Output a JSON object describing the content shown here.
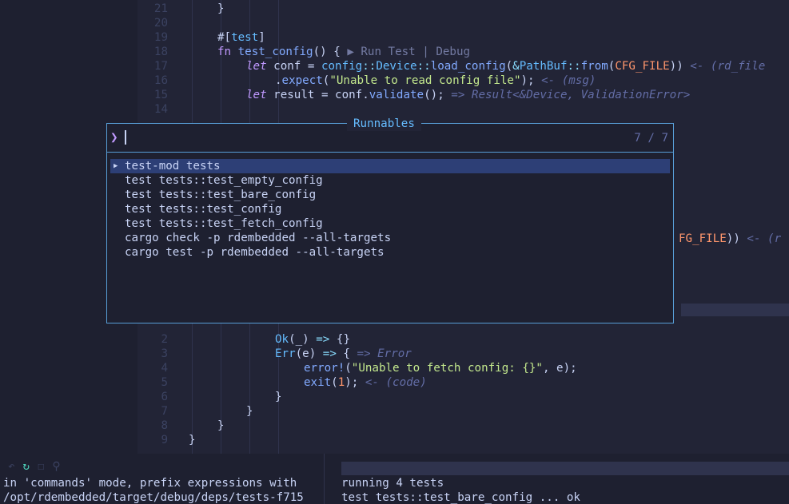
{
  "editor": {
    "lines_top": [
      {
        "n": "21",
        "indent": 100,
        "parts": [
          [
            "pl",
            "}"
          ]
        ]
      },
      {
        "n": "20",
        "indent": 0,
        "parts": []
      },
      {
        "n": "19",
        "indent": 100,
        "parts": [
          [
            "pl",
            "#["
          ],
          [
            "ty",
            "test"
          ],
          [
            "pl",
            "]"
          ]
        ]
      },
      {
        "n": "18",
        "indent": 100,
        "parts": [
          [
            "kw",
            "fn "
          ],
          [
            "fn",
            "test_config"
          ],
          [
            "pl",
            "() { "
          ],
          [
            "lens",
            "▶ Run Test | Debug"
          ]
        ]
      },
      {
        "n": "17",
        "indent": 136,
        "parts": [
          [
            "kwi",
            "let "
          ],
          [
            "pl",
            "conf = "
          ],
          [
            "ty",
            "config"
          ],
          [
            "op",
            "::"
          ],
          [
            "ty",
            "Device"
          ],
          [
            "op",
            "::"
          ],
          [
            "fn",
            "load_config"
          ],
          [
            "pl",
            "("
          ],
          [
            "op",
            "&"
          ],
          [
            "ty",
            "PathBuf"
          ],
          [
            "op",
            "::"
          ],
          [
            "fn",
            "from"
          ],
          [
            "pl",
            "("
          ],
          [
            "cst",
            "CFG_FILE"
          ],
          [
            "pl",
            ")) "
          ],
          [
            "hint",
            "<- (rd_file"
          ]
        ]
      },
      {
        "n": "16",
        "indent": 172,
        "parts": [
          [
            "pl",
            "."
          ],
          [
            "fn",
            "expect"
          ],
          [
            "pl",
            "("
          ],
          [
            "str",
            "\"Unable to read config file\""
          ],
          [
            "pl",
            "); "
          ],
          [
            "hint",
            "<- (msg)"
          ]
        ]
      },
      {
        "n": "15",
        "indent": 136,
        "parts": [
          [
            "kwi",
            "let "
          ],
          [
            "pl",
            "result = conf."
          ],
          [
            "fn",
            "validate"
          ],
          [
            "pl",
            "(); "
          ],
          [
            "hint",
            "=> Result<&Device, ValidationError>"
          ]
        ]
      },
      {
        "n": "14",
        "indent": 0,
        "parts": []
      }
    ],
    "lines_bottom": [
      {
        "n": "2",
        "indent": 172,
        "parts": [
          [
            "ty",
            "Ok"
          ],
          [
            "pl",
            "(_) "
          ],
          [
            "op",
            "=>"
          ],
          [
            "pl",
            " {}"
          ]
        ]
      },
      {
        "n": "3",
        "indent": 172,
        "parts": [
          [
            "ty",
            "Err"
          ],
          [
            "pl",
            "(e) "
          ],
          [
            "op",
            "=>"
          ],
          [
            "pl",
            " { "
          ],
          [
            "hint",
            "=> Error"
          ]
        ]
      },
      {
        "n": "4",
        "indent": 208,
        "parts": [
          [
            "fn",
            "error!"
          ],
          [
            "pl",
            "("
          ],
          [
            "str",
            "\"Unable to fetch config: {}\""
          ],
          [
            "pl",
            ", e);"
          ]
        ]
      },
      {
        "n": "5",
        "indent": 208,
        "parts": [
          [
            "fn",
            "exit"
          ],
          [
            "pl",
            "("
          ],
          [
            "num",
            "1"
          ],
          [
            "pl",
            "); "
          ],
          [
            "hint",
            "<- (code)"
          ]
        ]
      },
      {
        "n": "6",
        "indent": 172,
        "parts": [
          [
            "pl",
            "}"
          ]
        ]
      },
      {
        "n": "7",
        "indent": 136,
        "parts": [
          [
            "pl",
            "}"
          ]
        ]
      },
      {
        "n": "8",
        "indent": 100,
        "parts": [
          [
            "pl",
            "}"
          ]
        ]
      },
      {
        "n": "9",
        "indent": 64,
        "parts": [
          [
            "pl",
            "}"
          ]
        ]
      }
    ],
    "peek_right": [
      [
        "cst",
        "FG_FILE"
      ],
      [
        "pl",
        ")) "
      ],
      [
        "hint",
        "<- (r"
      ]
    ]
  },
  "palette": {
    "title": "Runnables",
    "input_value": "",
    "count": "7 / 7",
    "items": [
      "test-mod tests",
      "test tests::test_empty_config",
      "test tests::test_bare_config",
      "test tests::test_config",
      "test tests::test_fetch_config",
      "cargo check -p rdembedded --all-targets",
      "cargo test -p rdembedded --all-targets"
    ],
    "selected_index": 0
  },
  "terminal_left": {
    "toolbar_icons": [
      "undo-icon",
      "refresh-icon",
      "stop-icon",
      "pin-icon"
    ],
    "lines": [
      "in 'commands' mode, prefix expressions with",
      "/opt/rdembedded/target/debug/deps/tests-f715"
    ]
  },
  "terminal_right": {
    "lines": [
      "running 4 tests",
      "test tests::test_bare_config ... ok"
    ]
  }
}
